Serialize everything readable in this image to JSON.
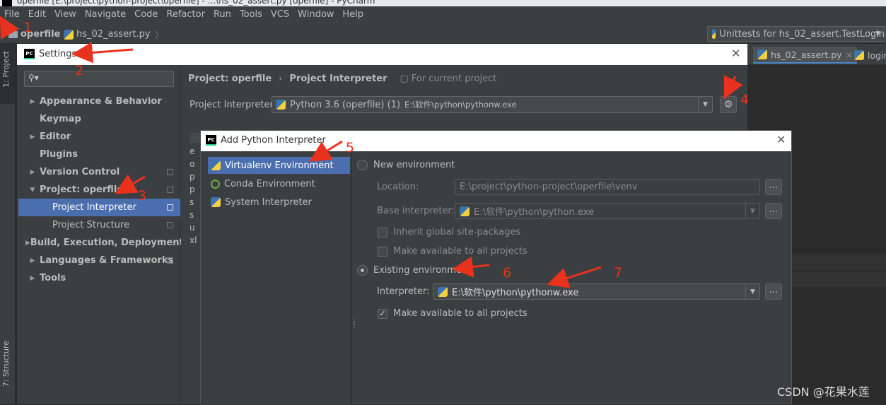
{
  "window": {
    "title": "operfile [E:\\project\\python-project\\operfile] - ...\\hs_02_assert.py [operfile] - PyCharm"
  },
  "menubar": [
    "File",
    "Edit",
    "View",
    "Navigate",
    "Code",
    "Refactor",
    "Run",
    "Tools",
    "VCS",
    "Window",
    "Help"
  ],
  "navbar": {
    "project": "operfile",
    "file": "hs_02_assert.py",
    "run_config": "Unittests for hs_02_assert.TestLogin"
  },
  "toolstrip": {
    "project_tab": "1: Project",
    "structure_tab": "7: Structure"
  },
  "editor_tabs": [
    {
      "label": "hs_02_assert.py"
    },
    {
      "label": "login"
    }
  ],
  "settings": {
    "title": "Settings",
    "search_placeholder": "",
    "tree": [
      {
        "label": "Appearance & Behavior",
        "arrow": "▶"
      },
      {
        "label": "Keymap",
        "arrow": ""
      },
      {
        "label": "Editor",
        "arrow": "▶"
      },
      {
        "label": "Plugins",
        "arrow": ""
      },
      {
        "label": "Version Control",
        "arrow": "▶"
      },
      {
        "label": "Project: operfile",
        "arrow": "▼"
      },
      {
        "label": "Project Interpreter",
        "arrow": ""
      },
      {
        "label": "Project Structure",
        "arrow": ""
      },
      {
        "label": "Build, Execution, Deployment",
        "arrow": "▶"
      },
      {
        "label": "Languages & Frameworks",
        "arrow": "▶"
      },
      {
        "label": "Tools",
        "arrow": "▶"
      }
    ],
    "breadcrumb": {
      "parent": "Project: operfile",
      "current": "Project Interpreter",
      "scope": "For current project"
    },
    "interpreter_label": "Project Interpreter:",
    "interpreter_value": "Python 3.6 (operfile) (1)",
    "interpreter_path": "E:\\软件\\python\\pythonw.exe",
    "packages_partial": [
      "e",
      "o",
      "p",
      "p",
      "s",
      "s",
      "u",
      "xl"
    ]
  },
  "add_interpreter": {
    "title": "Add Python Interpreter",
    "env_types": [
      "Virtualenv Environment",
      "Conda Environment",
      "System Interpreter"
    ],
    "new_env_label": "New environment",
    "location_label": "Location:",
    "location_value": "E:\\project\\python-project\\operfile\\venv",
    "base_interp_label": "Base interpreter:",
    "base_interp_value": "E:\\软件\\python\\python.exe",
    "inherit_label": "Inherit global site-packages",
    "make_available_new": "Make available to all projects",
    "existing_env_label": "Existing environment",
    "interpreter_label": "Interpreter:",
    "interpreter_value": "E:\\软件\\python\\pythonw.exe",
    "make_available_existing": "Make available to all projects",
    "browse_label": "..."
  },
  "annotations": [
    "1",
    "2",
    "3",
    "4",
    "5",
    "6",
    "7"
  ],
  "watermark": "CSDN @花果水莲",
  "colors": {
    "selection": "#4b6eaf",
    "dialog_bg": "#3c3f41",
    "annotation": "#e8321e"
  }
}
